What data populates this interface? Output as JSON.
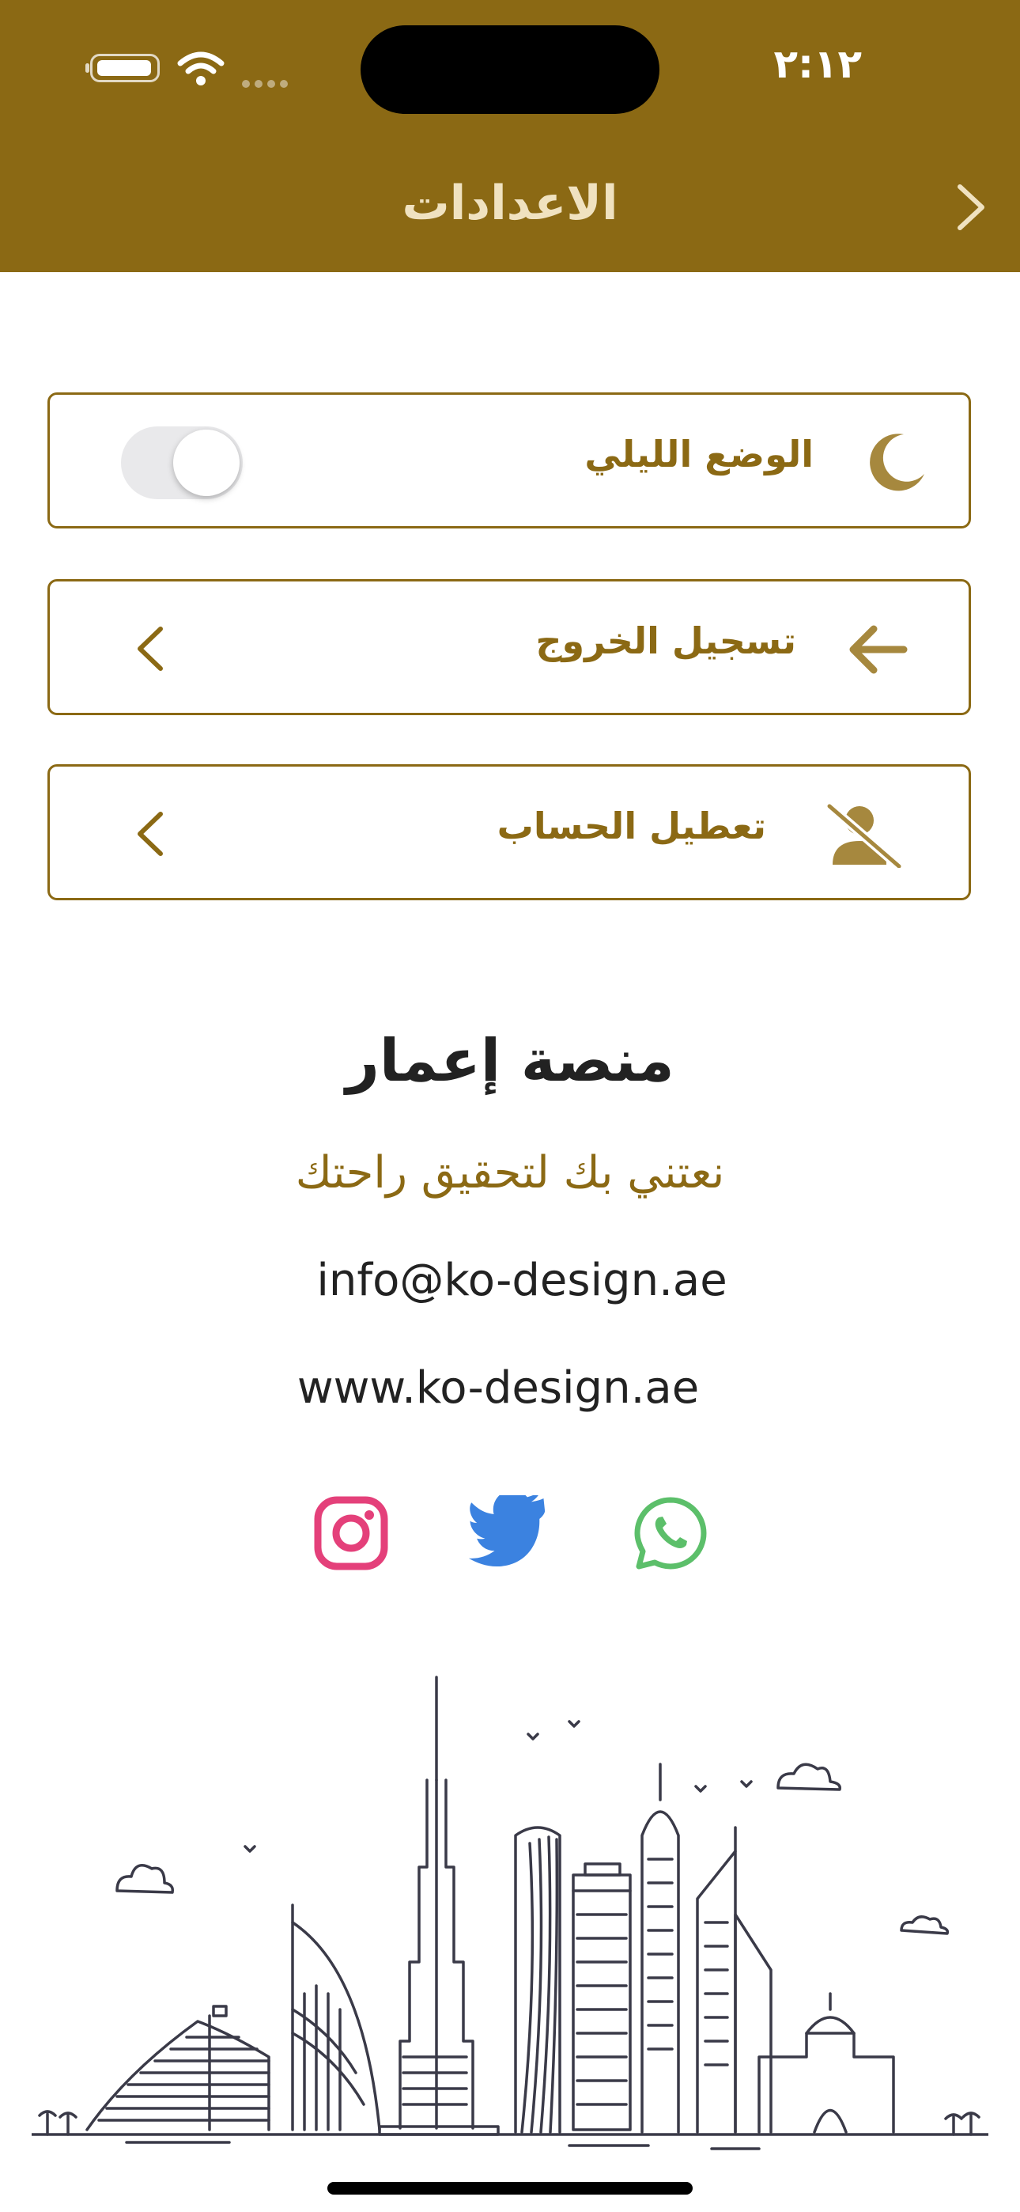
{
  "status_bar": {
    "time": "٢:١٢"
  },
  "header": {
    "title": "الاعدادات"
  },
  "settings": {
    "night_mode_label": "الوضع الليلي",
    "night_mode_enabled": false,
    "logout_label": "تسجيل الخروج",
    "deactivate_label": "تعطيل الحساب"
  },
  "footer": {
    "title": "منصة إعمار",
    "tagline": "نعتني بك لتحقيق راحتك",
    "email": "info@ko-design.ae",
    "website": "www.ko-design.ae"
  },
  "colors": {
    "brand": "#8B6914",
    "instagram": "#E4407A",
    "twitter": "#3B82E0",
    "whatsapp": "#5CBF6A"
  },
  "icons": [
    "moon-icon",
    "arrow-left-icon",
    "user-slash-icon",
    "chevron-left-icon",
    "instagram-icon",
    "twitter-icon",
    "whatsapp-icon"
  ]
}
